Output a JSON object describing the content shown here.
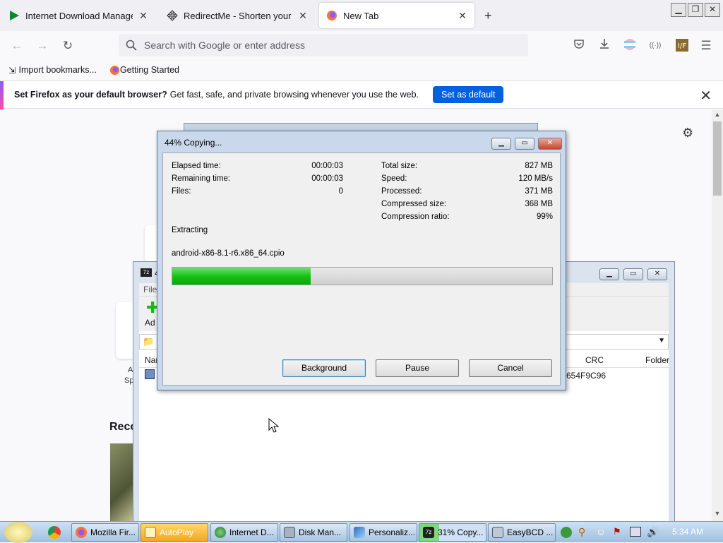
{
  "browser": {
    "tabs": [
      {
        "title": "Internet Download Manager: Th",
        "icon": "idm-play-icon",
        "active": false
      },
      {
        "title": "RedirectMe - Shorten your URL",
        "icon": "redirect-move-icon",
        "active": false
      },
      {
        "title": "New Tab",
        "icon": "firefox-icon",
        "active": true
      }
    ],
    "new_tab_glyph": "+",
    "address_placeholder": "Search with Google or enter address",
    "bookmarks": [
      {
        "label": "Import bookmarks...",
        "icon": "import-icon"
      },
      {
        "label": "Getting Started",
        "icon": "firefox-icon"
      }
    ],
    "infobar": {
      "bold": "Set Firefox as your default browser?",
      "text": "Get fast, safe, and private browsing whenever you use the web.",
      "button": "Set as default"
    }
  },
  "newtab": {
    "recent_heading": "Reco",
    "shortcut_label_a": "A",
    "shortcut_label_sp": "Sp"
  },
  "window_7z": {
    "title_prefix": "4",
    "menu_file": "File",
    "toolbar_add": "Ad",
    "columns": {
      "name": "Nar",
      "crc": "CRC",
      "folder": "Folder"
    },
    "row_crc": "654F9C96"
  },
  "dialog": {
    "title": "44% Copying...",
    "left_stats": [
      {
        "label": "Elapsed time:",
        "value": "00:00:03"
      },
      {
        "label": "Remaining time:",
        "value": "00:00:03"
      },
      {
        "label": "Files:",
        "value": "0"
      }
    ],
    "right_stats": [
      {
        "label": "Total size:",
        "value": "827 MB"
      },
      {
        "label": "Speed:",
        "value": "120 MB/s"
      },
      {
        "label": "Processed:",
        "value": "371 MB"
      },
      {
        "label": "Compressed size:",
        "value": "368 MB"
      },
      {
        "label": "Compression ratio:",
        "value": "99%"
      }
    ],
    "operation": "Extracting",
    "filename": "android-x86-8.1-r6.x86_64.cpio",
    "progress_fraction": 0.365,
    "buttons": {
      "background": "Background",
      "pause": "Pause",
      "cancel": "Cancel"
    }
  },
  "taskbar": {
    "items": [
      {
        "label": "Mozilla Fir...",
        "icon": "firefox-icon",
        "active": false
      },
      {
        "label": "AutoPlay",
        "icon": "autoplay-icon",
        "active": true
      },
      {
        "label": "Internet D...",
        "icon": "idm-globe-icon",
        "active": false
      },
      {
        "label": "Disk Man...",
        "icon": "disk-management-icon",
        "active": false
      },
      {
        "label": "Personaliz...",
        "icon": "personalize-icon",
        "active": false
      },
      {
        "label": "31% Copy...",
        "icon": "7zip-icon",
        "active": false
      },
      {
        "label": "EasyBCD ...",
        "icon": "easybcd-icon",
        "active": false
      }
    ],
    "clock": "5:34 AM"
  },
  "colors": {
    "accent_blue": "#0061e0",
    "progress_green": "#10c010",
    "taskbar_active": "#f5a623"
  }
}
